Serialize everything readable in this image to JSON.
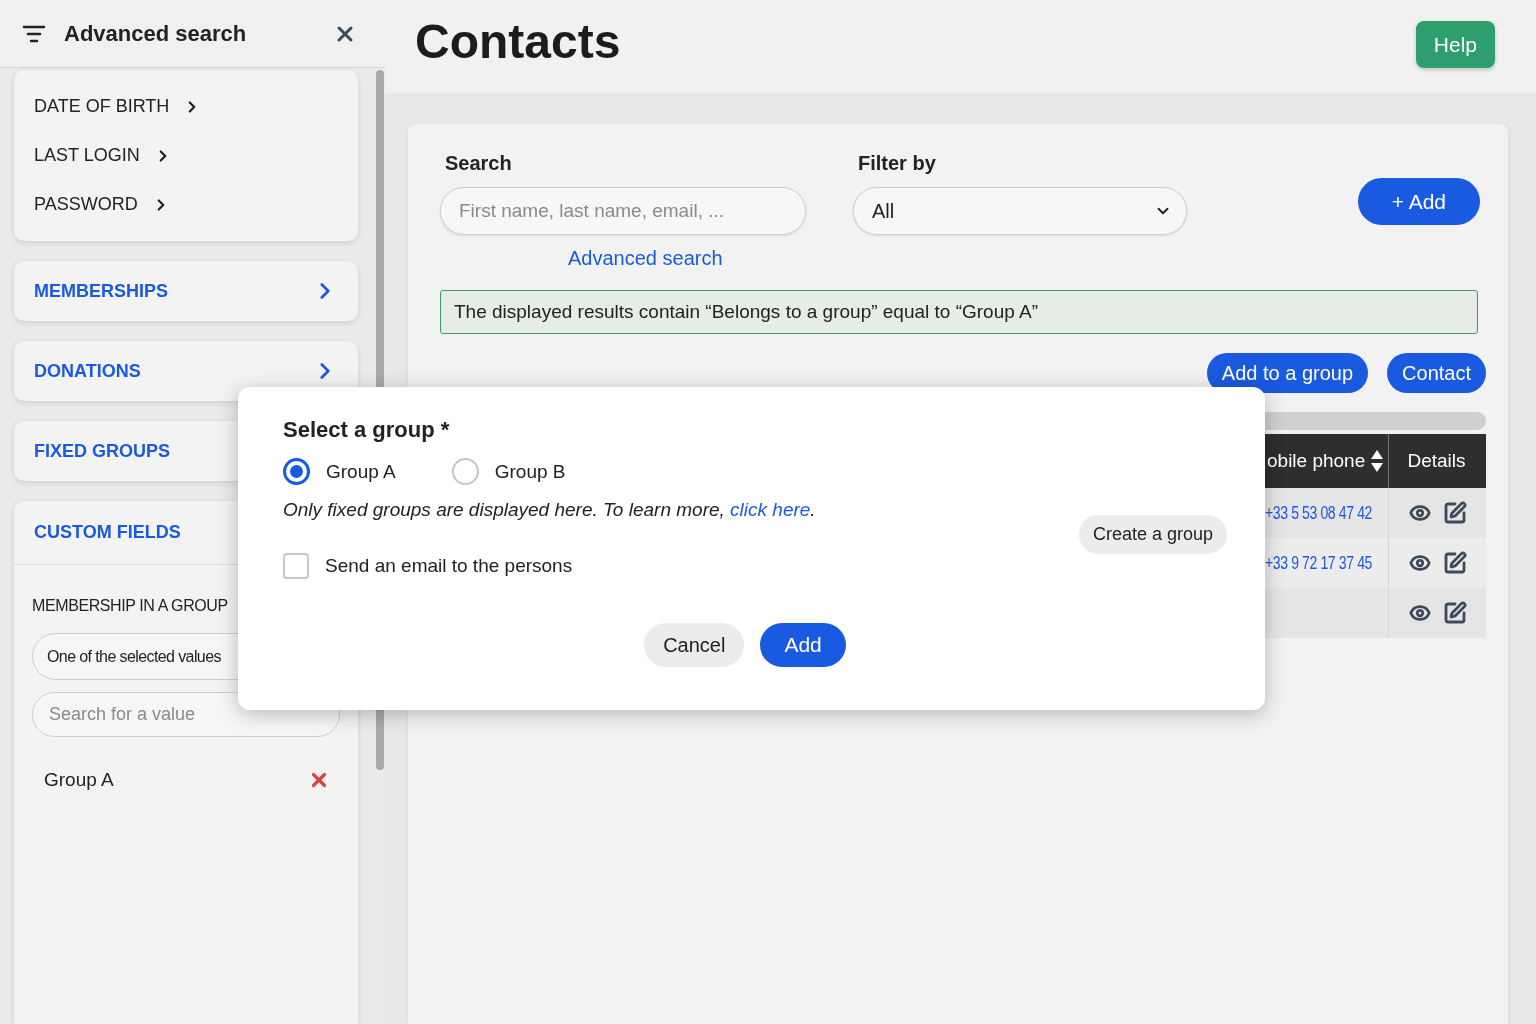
{
  "sidebar": {
    "title": "Advanced search",
    "criteria": [
      {
        "label": "DATE OF BIRTH"
      },
      {
        "label": "LAST LOGIN"
      },
      {
        "label": "PASSWORD"
      }
    ],
    "sections": [
      {
        "label": "MEMBERSHIPS"
      },
      {
        "label": "DONATIONS"
      }
    ],
    "partly_hidden_section": {
      "label": "FIXED GROUPS"
    },
    "custom_fields": {
      "title": "CUSTOM FIELDS",
      "field_label": "MEMBERSHIP IN A GROUP",
      "operator": "One of the selected values",
      "search_placeholder": "Search for a value",
      "values": [
        "Group A"
      ]
    }
  },
  "page": {
    "title": "Contacts",
    "help_button": "Help"
  },
  "search": {
    "label": "Search",
    "placeholder": "First name, last name, email, ...",
    "advanced_link": "Advanced search"
  },
  "filter": {
    "label": "Filter by",
    "value": "All"
  },
  "add_button": "+ Add",
  "notice": "The displayed results contain “Belongs to a group” equal to “Group A”",
  "actions": [
    "Add to a group",
    "Contact"
  ],
  "table": {
    "columns": [
      {
        "label": "obile phone",
        "sortable": true
      },
      {
        "label": "Details",
        "sortable": false
      }
    ],
    "rows": [
      {
        "phone": "+33 5 53 08 47 42"
      },
      {
        "phone": "+33 9 72 17 37 45"
      },
      {}
    ]
  },
  "dialog": {
    "title": "Select a group *",
    "options": [
      {
        "label": "Group A",
        "selected": true
      },
      {
        "label": "Group B",
        "selected": false
      }
    ],
    "note": "Only fixed groups are displayed here. To learn more, ",
    "note_link": "click here",
    "note_end": ".",
    "send_email": {
      "label": "Send an email to the persons",
      "checked": false
    },
    "create_button": "Create a group",
    "cancel_button": "Cancel",
    "confirm_button": "Add"
  }
}
